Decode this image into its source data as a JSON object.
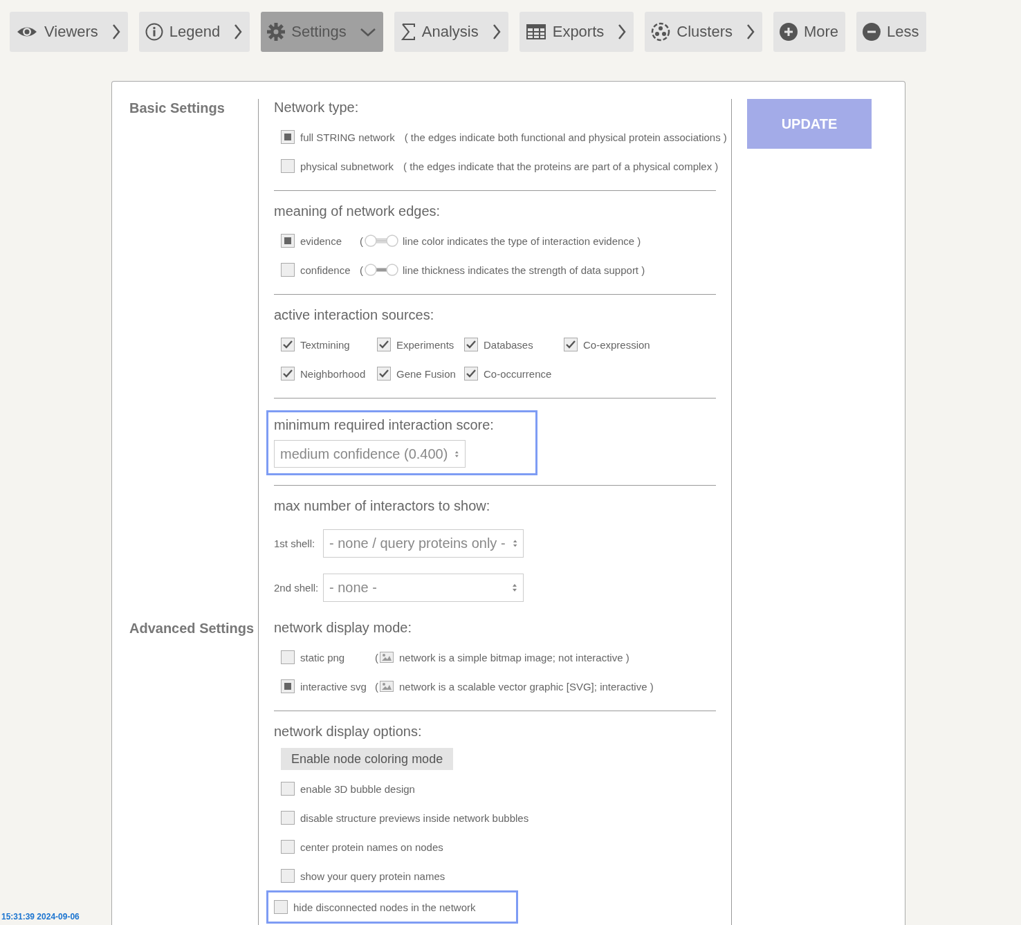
{
  "toolbar": [
    {
      "label": "Viewers",
      "selected": false
    },
    {
      "label": "Legend",
      "selected": false
    },
    {
      "label": "Settings",
      "selected": true
    },
    {
      "label": "Analysis",
      "selected": false
    },
    {
      "label": "Exports",
      "selected": false
    },
    {
      "label": "Clusters",
      "selected": false
    },
    {
      "label": "More",
      "selected": false
    },
    {
      "label": "Less",
      "selected": false
    }
  ],
  "update_button": "UPDATE",
  "sections": [
    {
      "title": "Basic Settings",
      "groups": [
        {
          "heading": "Network type:",
          "highlighted": false,
          "rows": [
            {
              "kind": "option",
              "label": "full STRING network",
              "note": "( the edges indicate both functional and physical protein associations )",
              "selected": true
            },
            {
              "kind": "option",
              "label": "physical subnetwork",
              "note": "( the edges indicate that the proteins are part of a physical complex )",
              "selected": false
            }
          ]
        },
        {
          "heading": "meaning of network edges:",
          "highlighted": false,
          "rows": [
            {
              "kind": "toggle",
              "label": "evidence",
              "paren": "(",
              "note": "line color indicates the type of interaction evidence )",
              "selected": true
            },
            {
              "kind": "toggle",
              "label": "confidence",
              "paren": "(",
              "note": "line thickness indicates the strength of data support )",
              "selected": false
            }
          ]
        },
        {
          "heading": "active interaction sources:",
          "highlighted": false,
          "rows": [
            {
              "kind": "checks",
              "items": [
                {
                  "label": "Textmining",
                  "checked": true
                },
                {
                  "label": "Experiments",
                  "checked": true
                },
                {
                  "label": "Databases",
                  "checked": true
                },
                {
                  "label": "Co-expression",
                  "checked": true
                },
                {
                  "label": "Neighborhood",
                  "checked": true
                },
                {
                  "label": "Gene Fusion",
                  "checked": true
                },
                {
                  "label": "Co-occurrence",
                  "checked": true
                }
              ]
            }
          ]
        },
        {
          "heading": "minimum required interaction score:",
          "highlighted": true,
          "rows": [
            {
              "kind": "select",
              "value": "medium confidence (0.400)"
            }
          ]
        },
        {
          "heading": "max number of interactors to show:",
          "highlighted": false,
          "rows": [
            {
              "kind": "shell",
              "label": "1st shell:",
              "value": "- none / query proteins only -"
            },
            {
              "kind": "shell",
              "label": "2nd shell:",
              "value": "- none -"
            }
          ]
        }
      ]
    },
    {
      "title": "Advanced Settings",
      "groups": [
        {
          "heading": "network display mode:",
          "highlighted": false,
          "rows": [
            {
              "kind": "image_option",
              "label": "static png",
              "paren": "(",
              "note": "network is a simple bitmap image; not interactive )",
              "selected": false
            },
            {
              "kind": "image_option",
              "label": "interactive svg",
              "paren": "(",
              "note": "network is a scalable vector graphic [SVG]; interactive )",
              "selected": true
            }
          ]
        },
        {
          "heading": "network display options:",
          "highlighted": false,
          "rows": [
            {
              "kind": "button",
              "label": "Enable node coloring mode"
            },
            {
              "kind": "check",
              "label": "enable 3D bubble design",
              "checked": false,
              "highlighted": false
            },
            {
              "kind": "check",
              "label": "disable structure previews inside network bubbles",
              "checked": false,
              "highlighted": false
            },
            {
              "kind": "check",
              "label": "center protein names on nodes",
              "checked": false,
              "highlighted": false
            },
            {
              "kind": "check",
              "label": "show your query protein names",
              "checked": false,
              "highlighted": false
            },
            {
              "kind": "check",
              "label": "hide disconnected nodes in the network",
              "checked": false,
              "highlighted": true
            }
          ]
        }
      ]
    }
  ],
  "timestamp": "15:31:39 2024-09-06"
}
